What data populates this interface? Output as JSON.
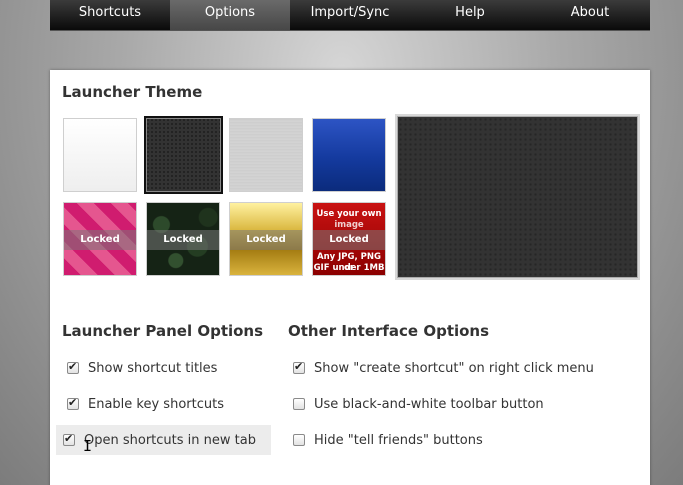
{
  "nav": {
    "tabs": [
      {
        "label": "Shortcuts"
      },
      {
        "label": "Options"
      },
      {
        "label": "Import/Sync"
      },
      {
        "label": "Help"
      },
      {
        "label": "About"
      }
    ],
    "active": "Options"
  },
  "theme_section": {
    "title": "Launcher Theme",
    "locked_label": "Locked",
    "custom_line1": "Use your own",
    "custom_line2": "image",
    "custom_line3": "Any JPG, PNG or",
    "custom_line4": "GIF under 1MB",
    "selected": "dark-carbon"
  },
  "launcher_panel": {
    "title": "Launcher Panel Options",
    "options": [
      {
        "label": "Show shortcut titles",
        "checked": true
      },
      {
        "label": "Enable key shortcuts",
        "checked": true
      },
      {
        "label": "Open shortcuts in new tab",
        "checked": true
      }
    ]
  },
  "other_interface": {
    "title": "Other Interface Options",
    "options": [
      {
        "label": "Show \"create shortcut\" on right click menu",
        "checked": true
      },
      {
        "label": "Use black-and-white toolbar button",
        "checked": false
      },
      {
        "label": "Hide \"tell friends\" buttons",
        "checked": false
      }
    ]
  },
  "colors": {
    "nav_bg": "#111111",
    "nav_active": "#555555",
    "panel_bg": "#ffffff"
  }
}
